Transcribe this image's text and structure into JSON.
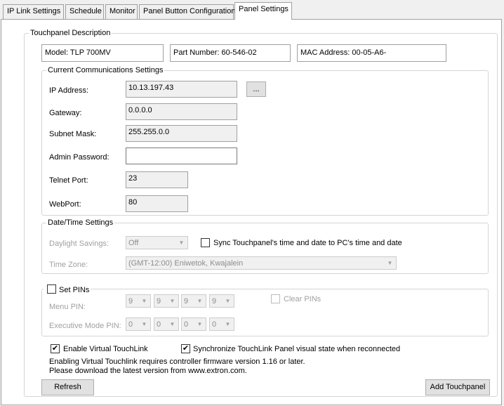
{
  "tabs": [
    {
      "label": "IP Link Settings"
    },
    {
      "label": "Schedule"
    },
    {
      "label": "Monitor"
    },
    {
      "label": "Panel Button Configuration"
    },
    {
      "label": "Panel Settings"
    }
  ],
  "description": {
    "legend": "Touchpanel Description",
    "model": "Model: TLP 700MV",
    "part_number": "Part Number: 60-546-02",
    "mac": "MAC Address: 00-05-A6-"
  },
  "comm": {
    "legend": "Current Communications Settings",
    "ip_label": "IP Address:",
    "ip_value": "10.13.197.43",
    "browse_label": "...",
    "gateway_label": "Gateway:",
    "gateway_value": "0.0.0.0",
    "subnet_label": "Subnet Mask:",
    "subnet_value": "255.255.0.0",
    "admin_label": "Admin Password:",
    "admin_value": "",
    "telnet_label": "Telnet Port:",
    "telnet_value": "23",
    "web_label": "WebPort:",
    "web_value": "80"
  },
  "datetime": {
    "legend": "Date/Time Settings",
    "daylight_label": "Daylight Savings:",
    "daylight_value": "Off",
    "sync_label": "Sync Touchpanel's time and date to PC's time and date",
    "sync_checked": false,
    "timezone_label": "Time Zone:",
    "timezone_value": "(GMT-12:00) Eniwetok, Kwajalein"
  },
  "pins": {
    "legend": "Set PINs",
    "set_checked": false,
    "menu_label": "Menu PIN:",
    "menu_digits": [
      "9",
      "9",
      "9",
      "9"
    ],
    "exec_label": "Executive Mode PIN:",
    "exec_digits": [
      "0",
      "0",
      "0",
      "0"
    ],
    "clear_label": "Clear PINs"
  },
  "virtual": {
    "enable_label": "Enable Virtual TouchLink",
    "enable_checked": true,
    "sync_label": "Synchronize TouchLink Panel visual state when reconnected",
    "sync_checked": true,
    "note_line1": "Enabling Virtual Touchlink requires controller firmware version 1.16 or later.",
    "note_line2": "Please download the latest version from www.extron.com."
  },
  "buttons": {
    "refresh": "Refresh",
    "add": "Add Touchpanel"
  }
}
